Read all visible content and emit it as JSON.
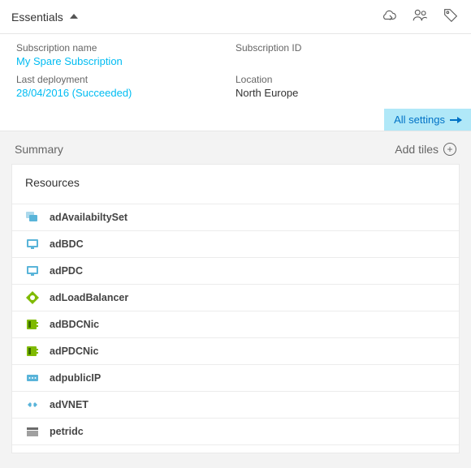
{
  "header": {
    "title": "Essentials"
  },
  "fields": {
    "subscription_name_label": "Subscription name",
    "subscription_name_value": "My Spare Subscription",
    "subscription_id_label": "Subscription ID",
    "subscription_id_value": "",
    "last_deployment_label": "Last deployment",
    "last_deployment_value": "28/04/2016 (Succeeded)",
    "location_label": "Location",
    "location_value": "North Europe"
  },
  "actions": {
    "all_settings": "All settings"
  },
  "summary": {
    "title": "Summary",
    "add_tiles": "Add tiles",
    "resources_title": "Resources"
  },
  "resources": [
    {
      "name": "adAvailabiltySet",
      "icon": "availability-set"
    },
    {
      "name": "adBDC",
      "icon": "vm"
    },
    {
      "name": "adPDC",
      "icon": "vm"
    },
    {
      "name": "adLoadBalancer",
      "icon": "load-balancer"
    },
    {
      "name": "adBDCNic",
      "icon": "nic"
    },
    {
      "name": "adPDCNic",
      "icon": "nic"
    },
    {
      "name": "adpublicIP",
      "icon": "public-ip"
    },
    {
      "name": "adVNET",
      "icon": "vnet"
    },
    {
      "name": "petridc",
      "icon": "storage"
    }
  ],
  "icon_colors": {
    "availability-set": "#59b4d9",
    "vm": "#59b4d9",
    "load-balancer": "#7fba00",
    "nic": "#7fba00",
    "public-ip": "#59b4d9",
    "vnet": "#59b4d9",
    "storage": "#a0a0a0"
  }
}
